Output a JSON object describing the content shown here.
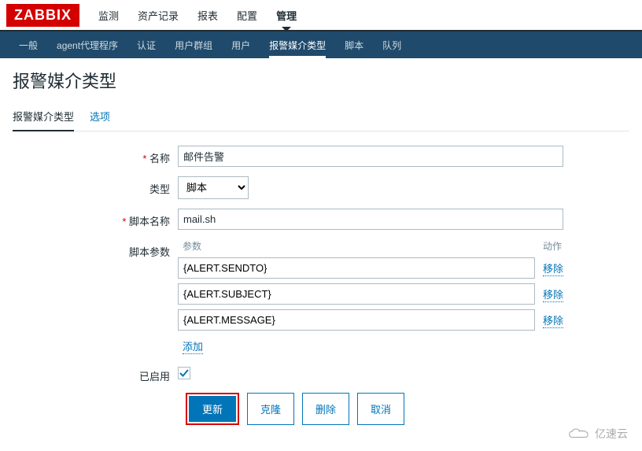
{
  "logo": "ZABBIX",
  "topnav": {
    "items": [
      "监测",
      "资产记录",
      "报表",
      "配置",
      "管理"
    ],
    "activeIndex": 4
  },
  "subnav": {
    "items": [
      "一般",
      "agent代理程序",
      "认证",
      "用户群组",
      "用户",
      "报警媒介类型",
      "脚本",
      "队列"
    ],
    "activeIndex": 5
  },
  "page": {
    "title": "报警媒介类型"
  },
  "tabs": {
    "items": [
      "报警媒介类型",
      "选项"
    ],
    "activeIndex": 0
  },
  "form": {
    "nameLabel": "名称",
    "nameValue": "邮件告警",
    "typeLabel": "类型",
    "typeValue": "脚本",
    "scriptNameLabel": "脚本名称",
    "scriptNameValue": "mail.sh",
    "scriptParamsLabel": "脚本参数",
    "paramsHeader": {
      "param": "参数",
      "action": "动作"
    },
    "params": [
      {
        "value": "{ALERT.SENDTO}"
      },
      {
        "value": "{ALERT.SUBJECT}"
      },
      {
        "value": "{ALERT.MESSAGE}"
      }
    ],
    "removeLabel": "移除",
    "addLabel": "添加",
    "enabledLabel": "已启用",
    "enabledChecked": true
  },
  "buttons": {
    "update": "更新",
    "clone": "克隆",
    "delete": "删除",
    "cancel": "取消"
  },
  "watermark": {
    "text": "亿速云"
  }
}
